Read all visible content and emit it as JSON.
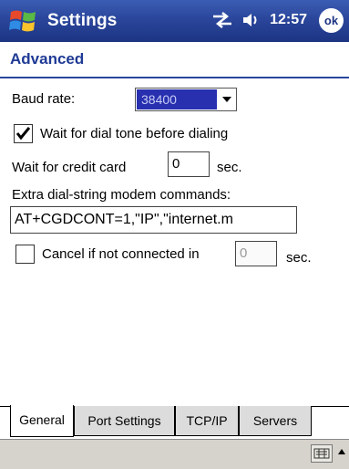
{
  "titlebar": {
    "title": "Settings",
    "time": "12:57",
    "ok_label": "ok",
    "icons": [
      "windows-start-icon",
      "connectivity-icon",
      "volume-icon"
    ]
  },
  "header": {
    "title": "Advanced"
  },
  "form": {
    "baud_label": "Baud rate:",
    "baud_value": "38400",
    "wait_dialtone_label": "Wait for dial tone before dialing",
    "wait_dialtone_checked": true,
    "credit_label": "Wait for credit card",
    "credit_value": "0",
    "credit_unit": "sec.",
    "extra_label": "Extra dial-string modem commands:",
    "extra_value": "AT+CGDCONT=1,\"IP\",\"internet.m",
    "cancel_label": "Cancel if not connected in",
    "cancel_checked": false,
    "cancel_value": "0",
    "cancel_unit": "sec."
  },
  "tabs": [
    {
      "label": "General",
      "active": true
    },
    {
      "label": "Port Settings",
      "active": false
    },
    {
      "label": "TCP/IP",
      "active": false
    },
    {
      "label": "Servers",
      "active": false
    }
  ],
  "colors": {
    "titlebar": "#2a469b",
    "accent": "#1f3a95",
    "selection": "#2830b0"
  }
}
